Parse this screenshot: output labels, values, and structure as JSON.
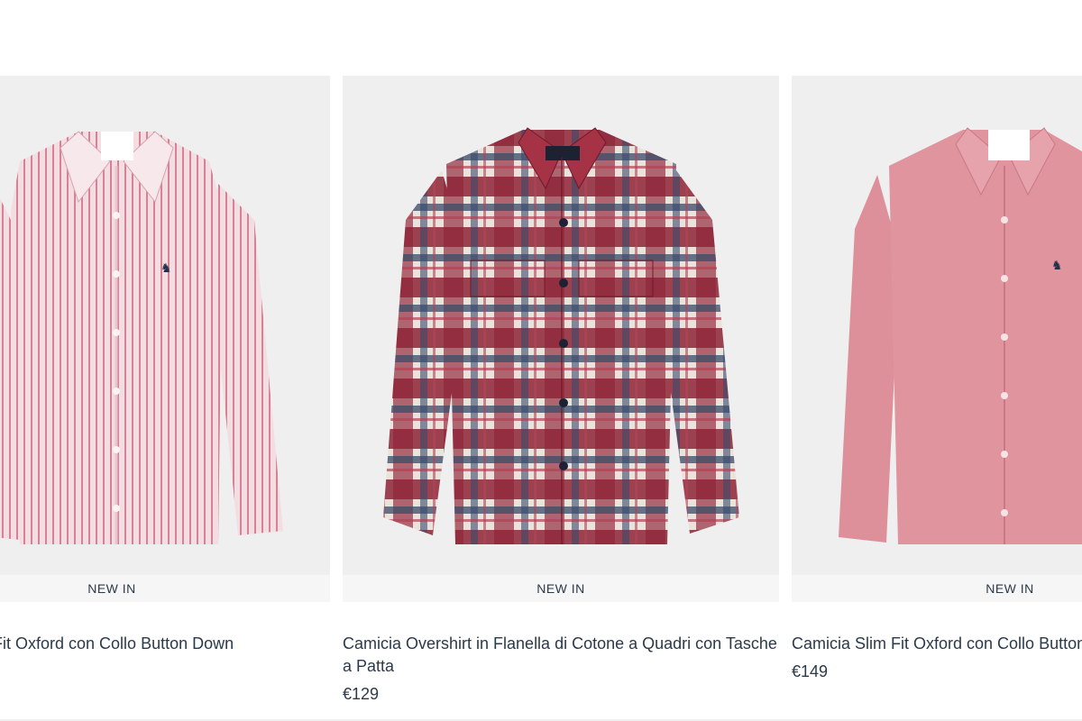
{
  "products": [
    {
      "badge": "NEW IN",
      "title": "Camicia Slim Fit Oxford con Collo Button Down",
      "price": "",
      "image_icon": "striped-pink-shirt-image",
      "colors": {
        "base": "#f1d6dc",
        "stripe": "#c25a6d"
      }
    },
    {
      "badge": "NEW IN",
      "title": "Camicia Overshirt in Flanella di Cotone a Quadri con Tasche a Patta",
      "price": "€129",
      "image_icon": "plaid-flannel-shirt-image",
      "colors": {
        "base": "#e7e1da",
        "red": "#8e2436",
        "navy": "#3b4a6b"
      }
    },
    {
      "badge": "NEW IN",
      "title": "Camicia Slim Fit Oxford con Collo Button Down",
      "price": "€149",
      "image_icon": "pink-oxford-shirt-image",
      "colors": {
        "base": "#dc8e98",
        "shade": "#c97884"
      }
    }
  ],
  "theme": {
    "text": "#2b3a4a",
    "image_bg": "#efefef",
    "badge_bg": "#f6f6f6"
  }
}
